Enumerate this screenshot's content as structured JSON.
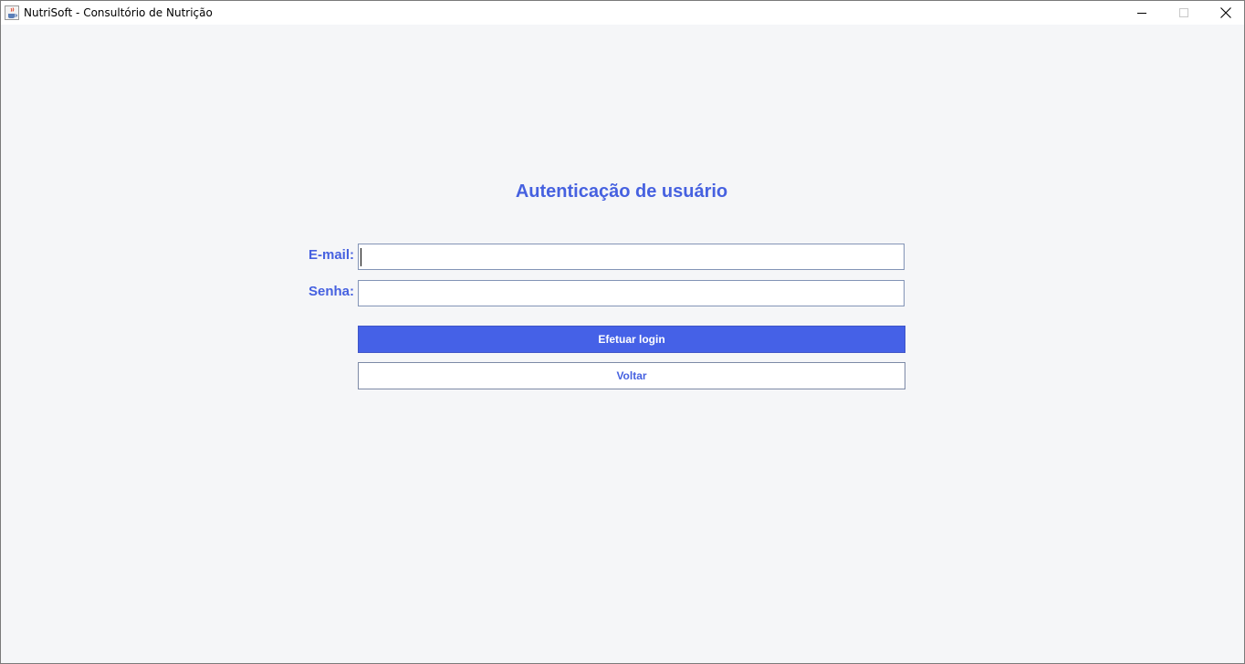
{
  "window": {
    "title": "NutriSoft - Consultório de Nutrição",
    "icon": "java-cup-icon",
    "controls": [
      "minimize-icon",
      "maximize-icon",
      "close-icon"
    ]
  },
  "form": {
    "heading": "Autenticação de usuário",
    "email_label": "E-mail:",
    "email_value": "",
    "senha_label": "Senha:",
    "senha_value": "",
    "login_button": "Efetuar login",
    "back_button": "Voltar"
  },
  "colors": {
    "accent": "#4561e7",
    "text_accent": "#4661e0",
    "background": "#f5f6f8"
  }
}
